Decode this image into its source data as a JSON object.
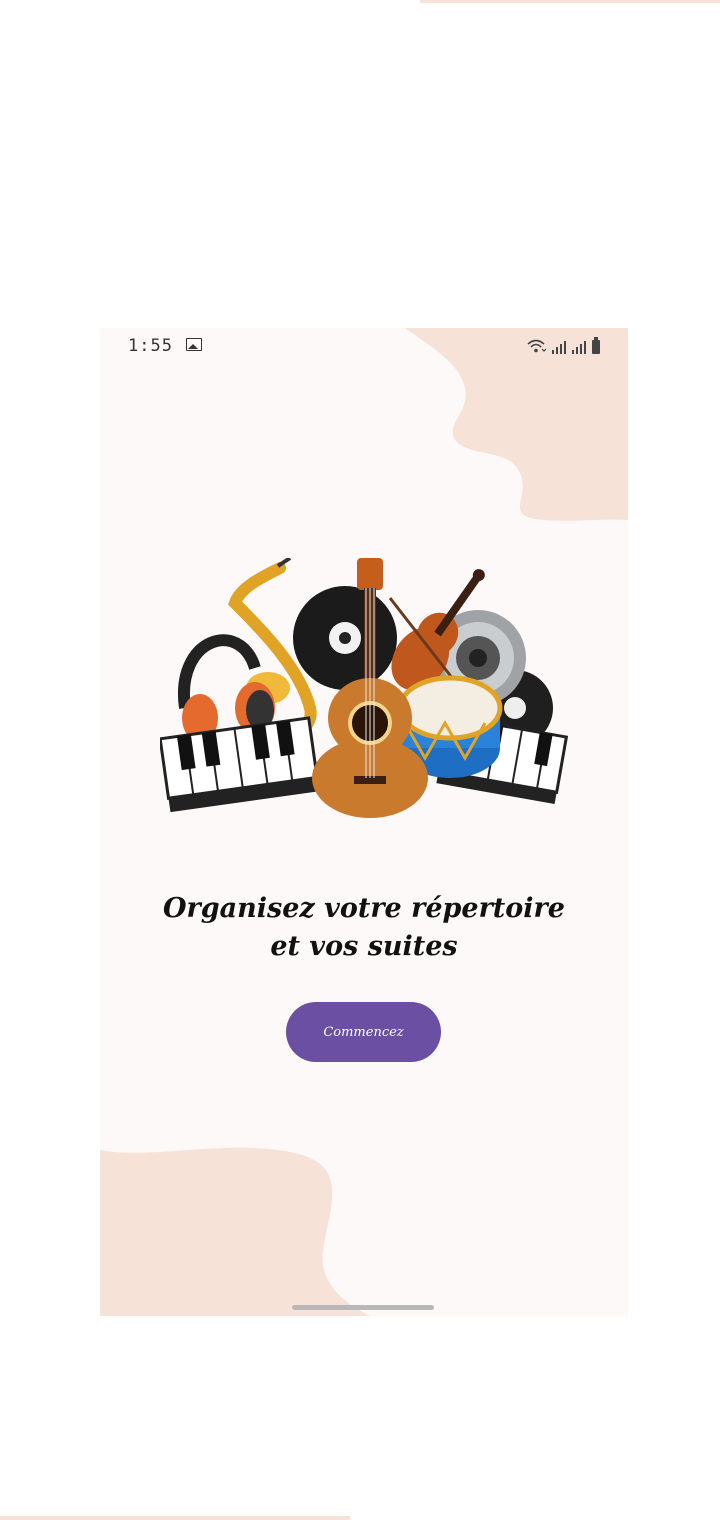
{
  "status_bar": {
    "time": "1:55",
    "icons": [
      "gallery-icon",
      "wifi-icon",
      "signal-icon",
      "signal-icon",
      "battery-icon"
    ]
  },
  "welcome": {
    "headline_line1": "Organisez votre répertoire",
    "headline_line2": "et vos suites",
    "button_label": "Commencez"
  },
  "colors": {
    "background": "#fdf9f9",
    "blob": "#f6e2d6",
    "accent": "#6a4fa3",
    "text": "#111111"
  }
}
